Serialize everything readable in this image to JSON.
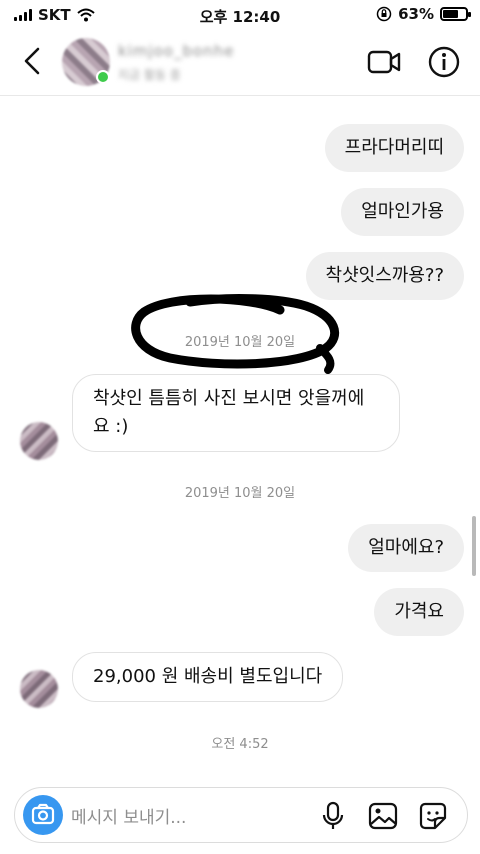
{
  "status_bar": {
    "carrier": "SKT",
    "time": "오후 12:40",
    "battery": "63%",
    "battery_level": 0.63
  },
  "header": {
    "username": "kimjoo_bonhe",
    "status": "지금 활동 중",
    "icons": {
      "back": "back-arrow-icon",
      "video": "video-camera-icon",
      "info": "info-icon"
    }
  },
  "messages": [
    {
      "type": "sent",
      "text": "프라다머리띠"
    },
    {
      "type": "sent",
      "text": "얼마인가용"
    },
    {
      "type": "sent",
      "text": "착샷잇스까용??"
    },
    {
      "type": "timestamp",
      "text": "2019년 10월 20일"
    },
    {
      "type": "received",
      "text": "착샷인 틈틈히 사진 보시면 앗을꺼에요 :)"
    },
    {
      "type": "timestamp",
      "text": "2019년 10월 20일"
    },
    {
      "type": "sent",
      "text": "얼마에요?"
    },
    {
      "type": "sent",
      "text": "가격요"
    },
    {
      "type": "received",
      "text": "29,000 원 배송비 별도입니다"
    },
    {
      "type": "timestamp",
      "text": "오전 4:52"
    }
  ],
  "composer": {
    "placeholder": "메시지 보내기...",
    "icons": {
      "camera": "camera-icon",
      "mic": "microphone-icon",
      "gallery": "gallery-icon",
      "sticker": "sticker-icon"
    }
  },
  "colors": {
    "accent": "#3797f0",
    "sent_bubble": "#efefef",
    "online": "#3fcb4c"
  }
}
